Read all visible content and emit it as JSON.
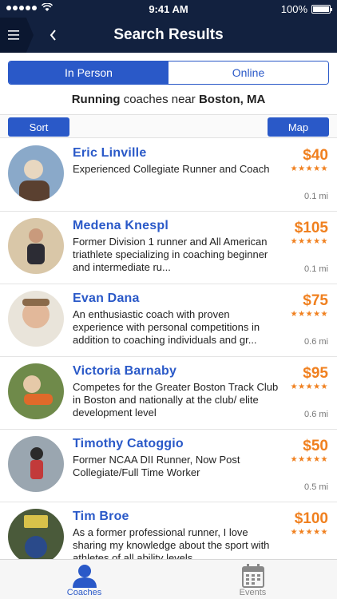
{
  "status": {
    "time": "9:41 AM",
    "battery": "100%"
  },
  "header": {
    "title": "Search Results"
  },
  "segment": {
    "in_person": "In Person",
    "online": "Online"
  },
  "subtitle": {
    "activity": "Running",
    "middle": " coaches near ",
    "location": "Boston, MA"
  },
  "actions": {
    "sort": "Sort",
    "map": "Map"
  },
  "coaches": [
    {
      "name": "Eric Linville",
      "desc": "Experienced Collegiate Runner and Coach",
      "price": "$40",
      "stars": "★★★★★",
      "distance": "0.1 mi",
      "colors": [
        "#8aa9c9",
        "#5a4030",
        "#e8d7c0"
      ]
    },
    {
      "name": "Medena Knespl",
      "desc": "Former Division 1 runner and All American triathlete specializing in coaching beginner and intermediate ru...",
      "price": "$105",
      "stars": "★★★★★",
      "distance": "0.1 mi",
      "colors": [
        "#d9c7a8",
        "#2c2c34",
        "#c99a7c"
      ]
    },
    {
      "name": "Evan Dana",
      "desc": "An enthusiastic coach with proven experience with personal competitions in addition to coaching individuals and gr...",
      "price": "$75",
      "stars": "★★★★★",
      "distance": "0.6 mi",
      "colors": [
        "#e9e4da",
        "#8a6a4a",
        "#e2b89a"
      ]
    },
    {
      "name": "Victoria Barnaby",
      "desc": "Competes for the Greater Boston Track Club in Boston and nationally at the club/ elite development level",
      "price": "$95",
      "stars": "★★★★★",
      "distance": "0.6 mi",
      "colors": [
        "#6f8a4a",
        "#e06a2a",
        "#e6c9a8"
      ]
    },
    {
      "name": "Timothy Catoggio",
      "desc": "Former NCAA DII Runner, Now Post Collegiate/Full Time Worker",
      "price": "$50",
      "stars": "★★★★★",
      "distance": "0.5 mi",
      "colors": [
        "#9aa6b0",
        "#2a2a2a",
        "#c23a3a"
      ]
    },
    {
      "name": "Tim Broe",
      "desc": "As a former professional runner, I love sharing my knowledge about the sport with athletes of all ability levels",
      "price": "$100",
      "stars": "★★★★★",
      "distance": "",
      "colors": [
        "#4a5a3a",
        "#d8c24a",
        "#2a4a8a"
      ]
    }
  ],
  "tabs": {
    "coaches": "Coaches",
    "events": "Events"
  },
  "icons": {
    "menu": "menu-icon",
    "back": "back-icon",
    "coaches": "person-icon",
    "events": "calendar-icon"
  },
  "theme": {
    "navy": "#12213f",
    "blue": "#2a59c8",
    "orange": "#f0801f"
  }
}
